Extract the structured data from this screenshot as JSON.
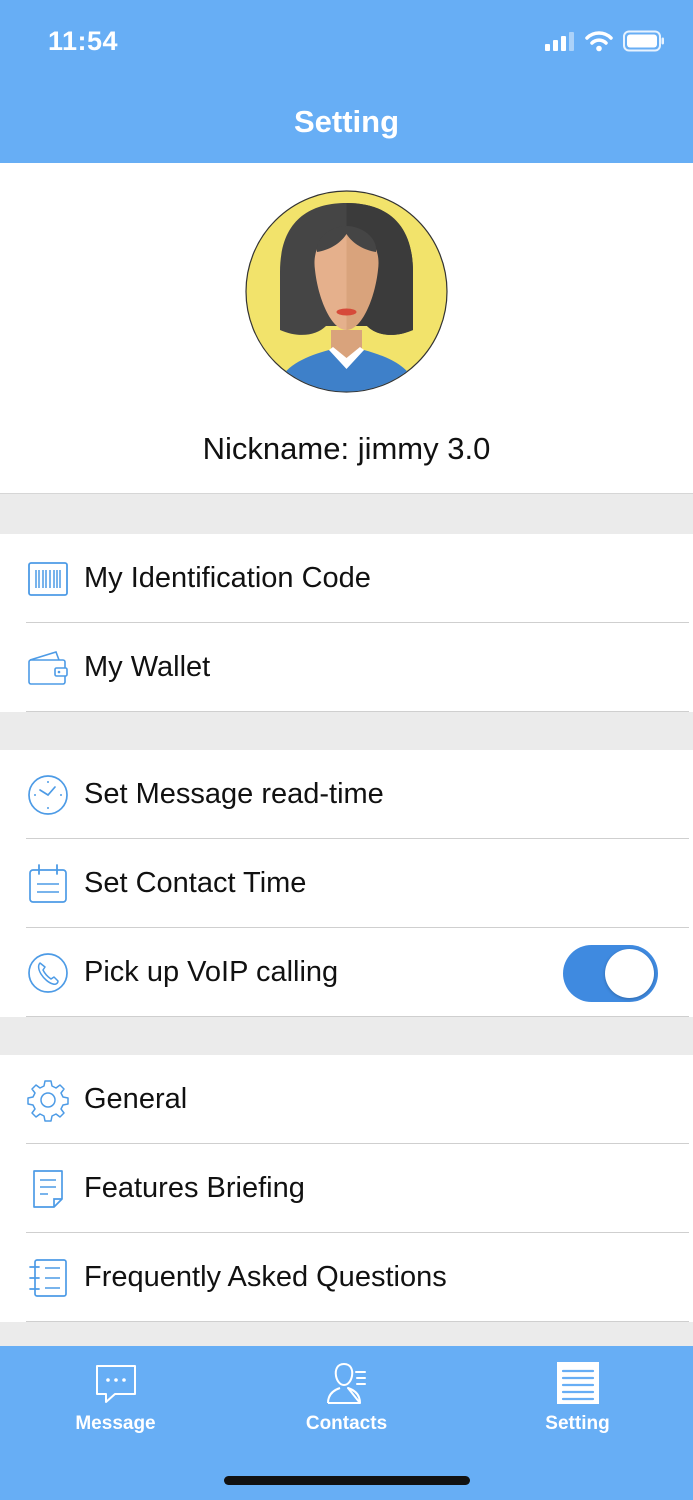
{
  "status_bar": {
    "time": "11:54"
  },
  "header": {
    "title": "Setting"
  },
  "profile": {
    "nickname": "Nickname: jimmy 3.0"
  },
  "groups": [
    {
      "items": [
        {
          "label": "My Identification Code",
          "icon": "barcode-icon"
        },
        {
          "label": "My Wallet",
          "icon": "wallet-icon"
        }
      ]
    },
    {
      "items": [
        {
          "label": "Set Message read-time",
          "icon": "clock-icon"
        },
        {
          "label": "Set Contact Time",
          "icon": "calendar-icon"
        },
        {
          "label": "Pick up VoIP calling",
          "icon": "phone-icon",
          "toggle_on": true
        }
      ]
    },
    {
      "items": [
        {
          "label": "General",
          "icon": "gear-icon"
        },
        {
          "label": "Features Briefing",
          "icon": "document-icon"
        },
        {
          "label": "Frequently Asked Questions",
          "icon": "list-icon"
        }
      ]
    }
  ],
  "tabbar": {
    "tabs": [
      {
        "label": "Message",
        "icon": "chat-icon"
      },
      {
        "label": "Contacts",
        "icon": "contacts-icon"
      },
      {
        "label": "Setting",
        "icon": "setting-list-icon",
        "active": true
      }
    ]
  },
  "colors": {
    "header": "#67aef5",
    "accent": "#3f8ae0",
    "icon_stroke": "#4d9be6"
  }
}
